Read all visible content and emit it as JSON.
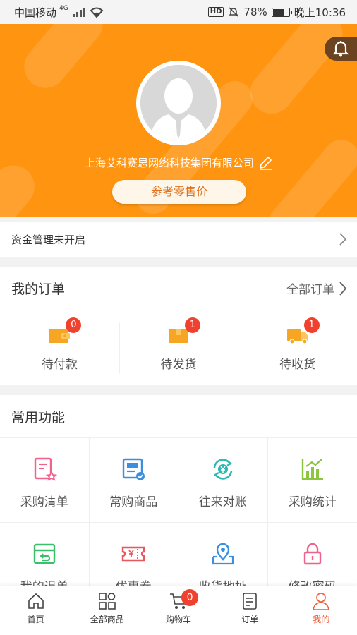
{
  "status_bar": {
    "carrier": "中国移动",
    "network": "4G",
    "hd": "HD",
    "battery": "78%",
    "battery_level": 0.78,
    "time": "晚上10:36"
  },
  "profile": {
    "company": "上海艾科赛思网络科技集团有限公司",
    "price_mode_button": "参考零售价"
  },
  "fund_management": {
    "label": "资金管理未开启"
  },
  "orders": {
    "title": "我的订单",
    "all_orders": "全部订单",
    "items": [
      {
        "label": "待付款",
        "count": "0",
        "icon": "wallet-icon"
      },
      {
        "label": "待发货",
        "count": "1",
        "icon": "package-icon"
      },
      {
        "label": "待收货",
        "count": "1",
        "icon": "truck-icon"
      }
    ]
  },
  "functions": {
    "title": "常用功能",
    "items": [
      {
        "label": "采购清单",
        "icon": "purchase-list-icon",
        "color": "#f0618c"
      },
      {
        "label": "常购商品",
        "icon": "frequent-goods-icon",
        "color": "#3a8fe0"
      },
      {
        "label": "往来对账",
        "icon": "reconcile-icon",
        "color": "#2fb8b0"
      },
      {
        "label": "采购统计",
        "icon": "stats-icon",
        "color": "#8cc63f"
      },
      {
        "label": "我的退单",
        "icon": "return-icon",
        "color": "#3cbf6a"
      },
      {
        "label": "优惠券",
        "icon": "coupon-icon",
        "color": "#e8575d"
      },
      {
        "label": "收货地址",
        "icon": "address-icon",
        "color": "#3a8fe0"
      },
      {
        "label": "修改密码",
        "icon": "lock-icon",
        "color": "#f0618c"
      }
    ]
  },
  "tabbar": {
    "items": [
      {
        "label": "首页",
        "icon": "home-icon"
      },
      {
        "label": "全部商品",
        "icon": "categories-icon"
      },
      {
        "label": "购物车",
        "icon": "cart-icon",
        "badge": "0"
      },
      {
        "label": "订单",
        "icon": "order-list-icon"
      },
      {
        "label": "我的",
        "icon": "user-icon",
        "active": true
      }
    ]
  },
  "colors": {
    "header": "#ff9410",
    "accent": "#ef5b3a",
    "badge": "#f0402e"
  }
}
